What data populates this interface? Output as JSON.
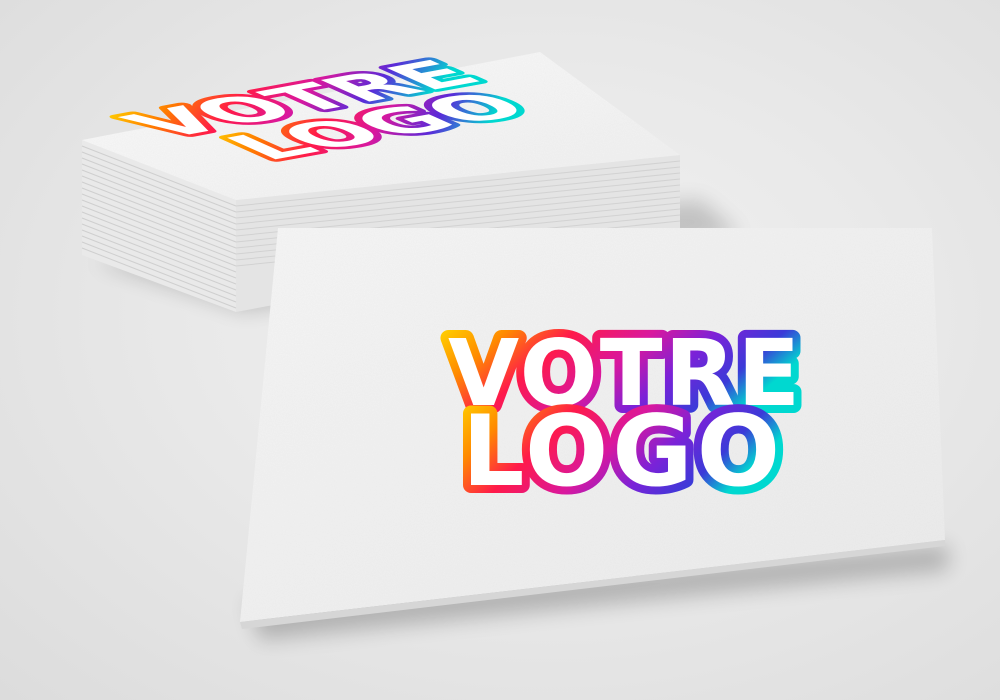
{
  "scene": {
    "description_free": true,
    "background_color": "#e6e6e6",
    "card_color": "#f7f7f7"
  },
  "logo": {
    "line1": "VOTRE",
    "line2": "LOGO",
    "gradient_colors": [
      "#ffd400",
      "#ff7a00",
      "#ff1a4a",
      "#e0189a",
      "#8a1fd6",
      "#3a2cd6",
      "#00e0d0"
    ]
  },
  "back_logo": {
    "line1": "VOTRE",
    "line2": "LOGO"
  }
}
